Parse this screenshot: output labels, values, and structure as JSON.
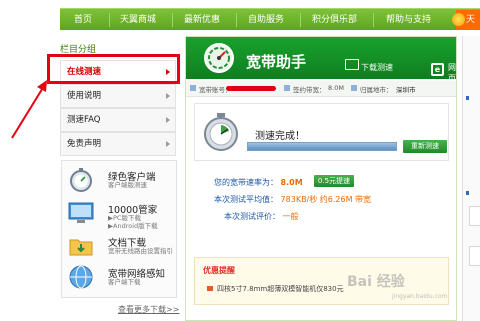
{
  "topnav": {
    "items": [
      "首页",
      "天翼商城",
      "最新优惠",
      "自助服务",
      "积分俱乐部",
      "帮助与支持"
    ],
    "brand": "天"
  },
  "sidebar": {
    "group_title": "栏目分组",
    "items": [
      {
        "label": "在线测速",
        "active": true
      },
      {
        "label": "使用说明",
        "active": false
      },
      {
        "label": "测速FAQ",
        "active": false
      },
      {
        "label": "免责声明",
        "active": false
      }
    ],
    "apps": [
      {
        "name": "绿色客户端",
        "desc": "客户端版测速",
        "icon": "stopwatch-icon"
      },
      {
        "name": "10000管家",
        "desc": "▶PC版下载\n▶Android版下载",
        "icon": "monitor-icon"
      },
      {
        "name": "文档下载",
        "desc": "宽带无线路由设置指引",
        "icon": "folder-icon"
      },
      {
        "name": "宽带网络感知",
        "desc": "客户端下载",
        "icon": "globe-icon"
      }
    ],
    "more_link": "查看更多下载>>"
  },
  "main": {
    "title": "宽带助手",
    "tabs": [
      "下载测速",
      "网页"
    ],
    "info": {
      "account_label": "宽带账号：",
      "signed_label": "签约带宽：",
      "signed_value": "8.0M",
      "region_label": "归属地市：",
      "region_value": "深圳市"
    },
    "test": {
      "status": "测速完成！",
      "progress": 1.0,
      "retest_label": "重新测速"
    },
    "results": {
      "rate_label": "您的宽带速率为：",
      "rate_value": "8.0M",
      "upgrade_label": "0.5元提速",
      "avg_label": "本次测试平均值：",
      "avg_value": "783KB/秒 约6.26M 带宽",
      "eval_label": "本次测试评价：",
      "eval_value": "一般"
    },
    "tips": {
      "title": "优惠提醒",
      "line": "四核5寸7.8mm超薄双模智能机仅830元"
    }
  },
  "watermark": {
    "main": "Bai 经验",
    "sub": "jingyan.baidu.com"
  },
  "colors": {
    "nav_green": "#6bb22a",
    "header_green": "#13922a",
    "highlight_red": "#e60012",
    "link_blue": "#1f57a4",
    "value_orange": "#ee6a00"
  }
}
